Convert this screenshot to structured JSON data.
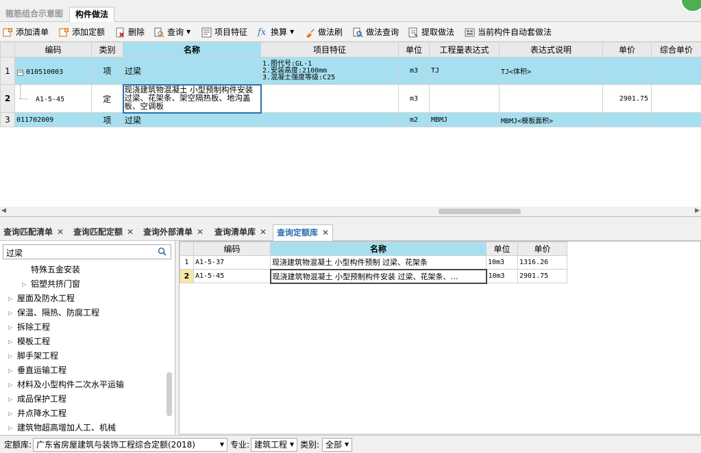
{
  "top_tabs": [
    {
      "label": "箍筋组合示意图"
    },
    {
      "label": "构件做法"
    }
  ],
  "toolbar": {
    "add_list": "添加清单",
    "add_quota": "添加定额",
    "delete": "删除",
    "query": "查询",
    "item_feature": "项目特征",
    "convert": "换算",
    "method_brush": "做法刷",
    "method_query": "做法查询",
    "extract_method": "提取做法",
    "auto_method": "当前构件自动套做法"
  },
  "main_grid": {
    "headers": [
      "编码",
      "类别",
      "名称",
      "项目特征",
      "单位",
      "工程量表达式",
      "表达式说明",
      "单价",
      "综合单价"
    ],
    "rows": [
      {
        "num": "1",
        "code": "010510003",
        "tree": "−",
        "type": "项",
        "name": "过梁",
        "feature": [
          "1.图代号:GL-1",
          "2.安装高度:2100mm",
          "3.混凝土强度等级:C25"
        ],
        "unit": "m3",
        "expr": "TJ",
        "expr_desc": "TJ<体积>",
        "price": "",
        "total": ""
      },
      {
        "num": "2",
        "code": "A1-5-45",
        "type": "定",
        "name": "现浇建筑物混凝土 小型预制构件安装 过梁、花架条、架空隔热板、地沟盖板、空调板",
        "feature": "",
        "unit": "m3",
        "expr": "",
        "expr_desc": "",
        "price": "2901.75",
        "total": ""
      },
      {
        "num": "3",
        "code": "011702009",
        "type": "项",
        "name": "过梁",
        "feature": "",
        "unit": "m2",
        "expr": "MBMJ",
        "expr_desc": "MBMJ<模板面积>",
        "price": "",
        "total": ""
      }
    ]
  },
  "bottom_tabs": [
    {
      "label": "查询匹配清单"
    },
    {
      "label": "查询匹配定额"
    },
    {
      "label": "查询外部清单"
    },
    {
      "label": "查询清单库"
    },
    {
      "label": "查询定额库"
    }
  ],
  "search": {
    "value": "过梁"
  },
  "tree": [
    {
      "label": "特殊五金安装"
    },
    {
      "label": "铝塑共挤门窗"
    },
    {
      "label": "屋面及防水工程"
    },
    {
      "label": "保温、隔热、防腐工程"
    },
    {
      "label": "拆除工程"
    },
    {
      "label": "模板工程"
    },
    {
      "label": "脚手架工程"
    },
    {
      "label": "垂直运输工程"
    },
    {
      "label": "材料及小型构件二次水平运输"
    },
    {
      "label": "成品保护工程"
    },
    {
      "label": "井点降水工程"
    },
    {
      "label": "建筑物超高增加人工、机械"
    }
  ],
  "result_grid": {
    "headers": [
      "编码",
      "名称",
      "单位",
      "单价"
    ],
    "rows": [
      {
        "num": "1",
        "code": "A1-5-37",
        "name": "现浇建筑物混凝土 小型构件预制 过梁、花架条",
        "unit": "10m3",
        "price": "1316.26"
      },
      {
        "num": "2",
        "code": "A1-5-45",
        "name": "现浇建筑物混凝土 小型预制构件安装 过梁、花架条、…",
        "unit": "10m3",
        "price": "2901.75"
      }
    ]
  },
  "status": {
    "quota_lib_label": "定额库:",
    "quota_lib_value": "广东省房屋建筑与装饰工程综合定额(2018)",
    "major_label": "专业:",
    "major_value": "建筑工程",
    "category_label": "类别:",
    "category_value": "全部"
  },
  "colors": {
    "row_highlight": "#a6e0f0",
    "selected_header": "#a6e0f0",
    "active_tab_text": "#2a6fb0"
  }
}
